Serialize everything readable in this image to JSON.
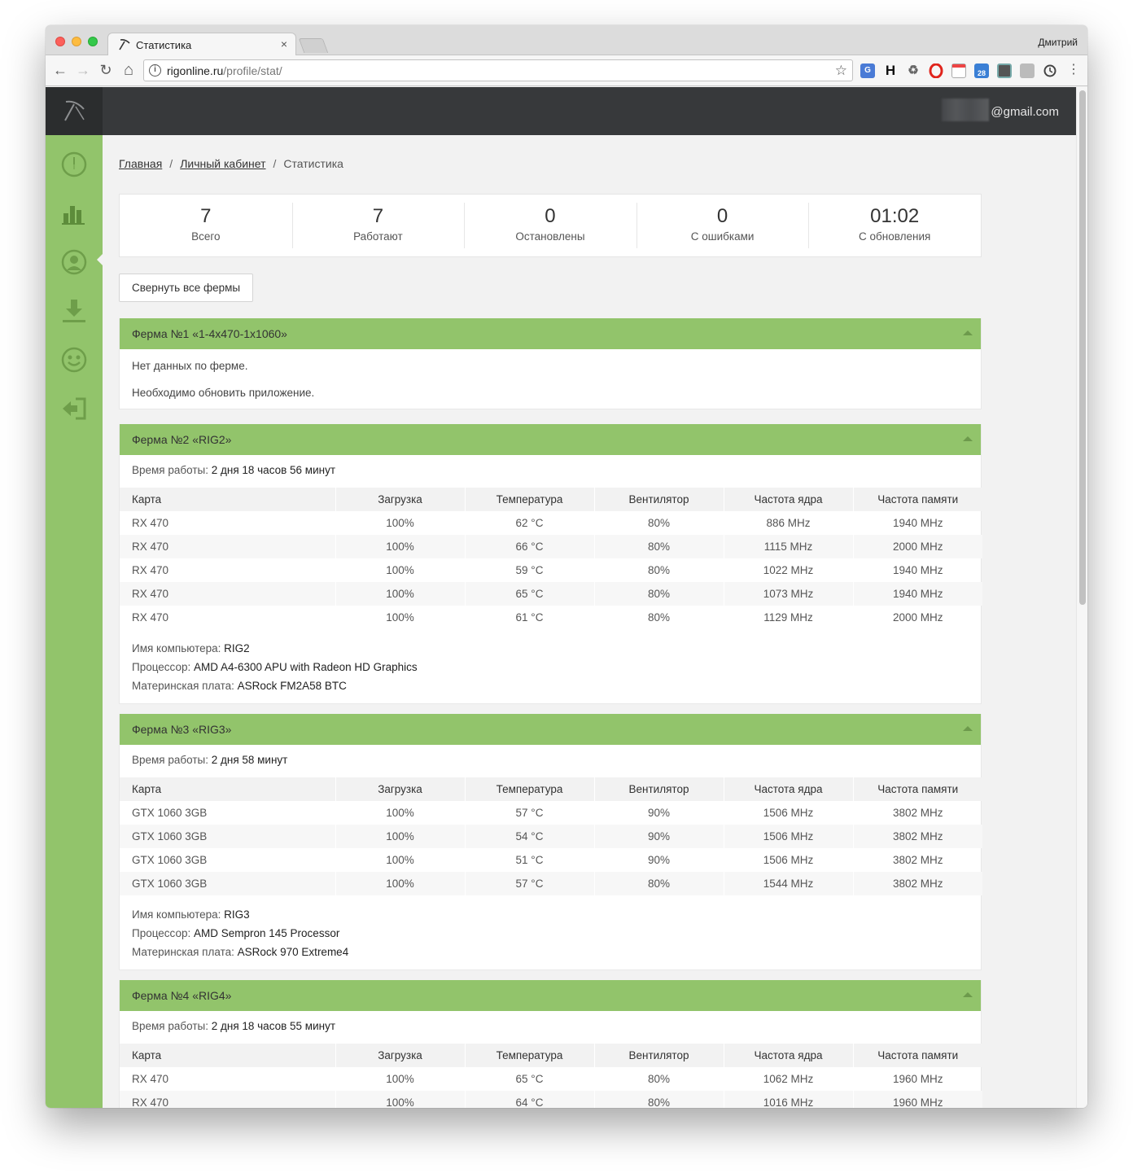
{
  "browser": {
    "tab_title": "Статистика",
    "tab_close": "×",
    "profile": "Дмитрий",
    "url_host": "rigonline.ru",
    "url_path": "/profile/stat/",
    "nav": {
      "back": "←",
      "forward": "→",
      "reload": "↻",
      "home": "⌂",
      "info": "i",
      "star": "☆",
      "menu": "⋮"
    },
    "extensions": [
      "translate-icon",
      "h-icon",
      "recycle-icon",
      "opera-icon",
      "calendar-icon",
      "calendar-28-icon",
      "photo-icon",
      "ghost-icon",
      "clock-icon"
    ],
    "ext_labels": {
      "h": "H",
      "calendar_day": "28"
    }
  },
  "header": {
    "email_suffix": "@gmail.com"
  },
  "sidebar": {
    "items": [
      "dashboard-icon",
      "stats-icon",
      "profile-icon",
      "download-icon",
      "support-icon",
      "logout-icon"
    ],
    "active": "stats-icon"
  },
  "breadcrumb": {
    "home": "Главная",
    "cabinet": "Личный кабинет",
    "sep": "/",
    "current": "Статистика"
  },
  "stats": [
    {
      "value": "7",
      "label": "Всего"
    },
    {
      "value": "7",
      "label": "Работают"
    },
    {
      "value": "0",
      "label": "Остановлены"
    },
    {
      "value": "0",
      "label": "С ошибками"
    },
    {
      "value": "01:02",
      "label": "С обновления"
    }
  ],
  "collapse_button": "Свернуть все фермы",
  "labels": {
    "uptime": "Время работы:",
    "computer": "Имя компьютера:",
    "cpu": "Процессор:",
    "board": "Материнская плата:"
  },
  "table_headers": [
    "Карта",
    "Загрузка",
    "Температура",
    "Вентилятор",
    "Частота ядра",
    "Частота памяти"
  ],
  "farms": [
    {
      "title": "Ферма №1 «1-4x470-1x1060»",
      "messages": [
        "Нет данных по ферме.",
        "Необходимо обновить приложение."
      ]
    },
    {
      "title": "Ферма №2 «RIG2»",
      "uptime": "2 дня 18 часов 56 минут",
      "rows": [
        [
          "RX 470",
          "100%",
          "62 °C",
          "80%",
          "886 MHz",
          "1940 MHz"
        ],
        [
          "RX 470",
          "100%",
          "66 °C",
          "80%",
          "1115 MHz",
          "2000 MHz"
        ],
        [
          "RX 470",
          "100%",
          "59 °C",
          "80%",
          "1022 MHz",
          "1940 MHz"
        ],
        [
          "RX 470",
          "100%",
          "65 °C",
          "80%",
          "1073 MHz",
          "1940 MHz"
        ],
        [
          "RX 470",
          "100%",
          "61 °C",
          "80%",
          "1129 MHz",
          "2000 MHz"
        ]
      ],
      "computer": "RIG2",
      "cpu": "AMD A4-6300 APU with Radeon HD Graphics",
      "board": "ASRock FM2A58 BTC"
    },
    {
      "title": "Ферма №3 «RIG3»",
      "uptime": "2 дня 58 минут",
      "rows": [
        [
          "GTX 1060 3GB",
          "100%",
          "57 °C",
          "90%",
          "1506 MHz",
          "3802 MHz"
        ],
        [
          "GTX 1060 3GB",
          "100%",
          "54 °C",
          "90%",
          "1506 MHz",
          "3802 MHz"
        ],
        [
          "GTX 1060 3GB",
          "100%",
          "51 °C",
          "90%",
          "1506 MHz",
          "3802 MHz"
        ],
        [
          "GTX 1060 3GB",
          "100%",
          "57 °C",
          "80%",
          "1544 MHz",
          "3802 MHz"
        ]
      ],
      "computer": "RIG3",
      "cpu": "AMD Sempron 145 Processor",
      "board": "ASRock 970 Extreme4"
    },
    {
      "title": "Ферма №4 «RIG4»",
      "uptime": "2 дня 18 часов 55 минут",
      "rows": [
        [
          "RX 470",
          "100%",
          "65 °C",
          "80%",
          "1062 MHz",
          "1960 MHz"
        ],
        [
          "RX 470",
          "100%",
          "64 °C",
          "80%",
          "1016 MHz",
          "1960 MHz"
        ]
      ]
    }
  ],
  "colors": {
    "accent_green": "#92c46b",
    "topbar": "#37393b",
    "logo_bg": "#2b2d2e"
  }
}
